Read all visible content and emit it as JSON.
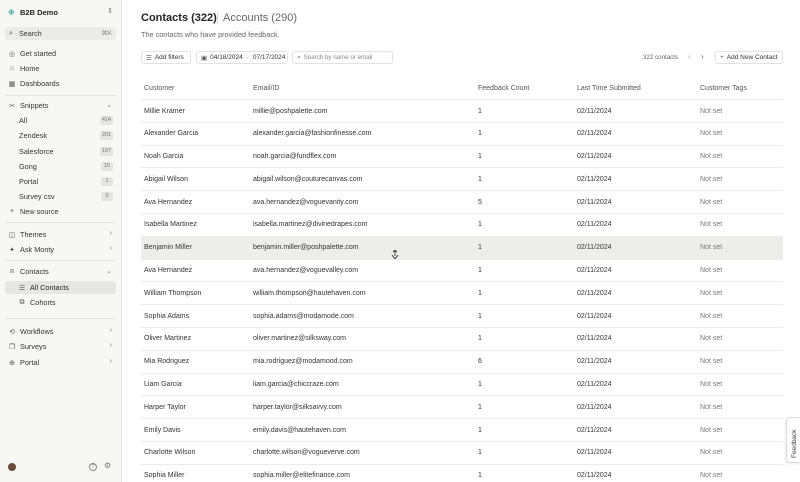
{
  "sidebar": {
    "workspace": "B2B Demo",
    "search_label": "Search",
    "search_shortcut": "⌘K",
    "get_started": "Get started",
    "home": "Home",
    "dashboards": "Dashboards",
    "snippets": "Snippets",
    "snippet_items": [
      {
        "label": "All",
        "count": "414"
      },
      {
        "label": "Zendesk",
        "count": "201"
      },
      {
        "label": "Salesforce",
        "count": "197"
      },
      {
        "label": "Gong",
        "count": "15"
      },
      {
        "label": "Portal",
        "count": "1"
      },
      {
        "label": "Survey csv",
        "count": "0"
      }
    ],
    "new_source": "New source",
    "themes": "Themes",
    "ask_monty": "Ask Monty",
    "contacts": "Contacts",
    "all_contacts": "All Contacts",
    "cohorts": "Cohorts",
    "workflows": "Workflows",
    "surveys": "Surveys",
    "portal": "Portal"
  },
  "header": {
    "title": "Contacts (322)",
    "tab_accounts": "Accounts (290)",
    "subtitle": "The contacts who have provided feedback."
  },
  "toolbar": {
    "add_filters": "Add filters",
    "date_start": "04/18/2024",
    "date_sep": "-",
    "date_end": "07/17/2024",
    "search_placeholder": "Search by name or email",
    "contacts_count": "322 contacts",
    "add_new_contact": "Add New Contact"
  },
  "table": {
    "columns": [
      "Customer",
      "Email/ID",
      "Feedback Count",
      "Last Time Submitted",
      "Customer Tags"
    ],
    "rows": [
      [
        "Millie Kramer",
        "millie@poshpalette.com",
        "1",
        "02/11/2024",
        "Not set"
      ],
      [
        "Alexander Garcia",
        "alexander.garcia@fashionfinesse.com",
        "1",
        "02/11/2024",
        "Not set"
      ],
      [
        "Noah Garcia",
        "noah.garcia@fundflex.com",
        "1",
        "02/11/2024",
        "Not set"
      ],
      [
        "Abigail Wilson",
        "abigail.wilson@couturecanvas.com",
        "1",
        "02/11/2024",
        "Not set"
      ],
      [
        "Ava Hernandez",
        "ava.hernandez@voguevanity.com",
        "5",
        "02/11/2024",
        "Not set"
      ],
      [
        "Isabella Martinez",
        "isabella.martinez@divinedrapes.com",
        "1",
        "02/11/2024",
        "Not set"
      ],
      [
        "Benjamin Miller",
        "benjamin.miller@poshpalette.com",
        "1",
        "02/11/2024",
        "Not set"
      ],
      [
        "Ava Hernandez",
        "ava.hernandez@voguevalley.com",
        "1",
        "02/11/2024",
        "Not set"
      ],
      [
        "William Thompson",
        "william.thompson@hautehaven.com",
        "1",
        "02/11/2024",
        "Not set"
      ],
      [
        "Sophia Adams",
        "sophia.adams@modamode.com",
        "1",
        "02/11/2024",
        "Not set"
      ],
      [
        "Oliver Martinez",
        "oliver.martinez@silksway.com",
        "1",
        "02/11/2024",
        "Not set"
      ],
      [
        "Mia Rodriguez",
        "mia.rodriguez@modamood.com",
        "6",
        "02/11/2024",
        "Not set"
      ],
      [
        "Liam Garcia",
        "liam.garcia@chiccraze.com",
        "1",
        "02/11/2024",
        "Not set"
      ],
      [
        "Harper Taylor",
        "harper.taylor@silksavvy.com",
        "1",
        "02/11/2024",
        "Not set"
      ],
      [
        "Emily Davis",
        "emily.davis@hautehaven.com",
        "1",
        "02/11/2024",
        "Not set"
      ],
      [
        "Charlotte Wilson",
        "charlotte.wilson@vogueverve.com",
        "1",
        "02/11/2024",
        "Not set"
      ],
      [
        "Sophia Miller",
        "sophia.miller@elitefinance.com",
        "1",
        "02/11/2024",
        "Not set"
      ]
    ]
  },
  "feedback_tab": "Feedback",
  "colors": {
    "accent": "#2a9d8f",
    "row_hover": "#ededec"
  }
}
